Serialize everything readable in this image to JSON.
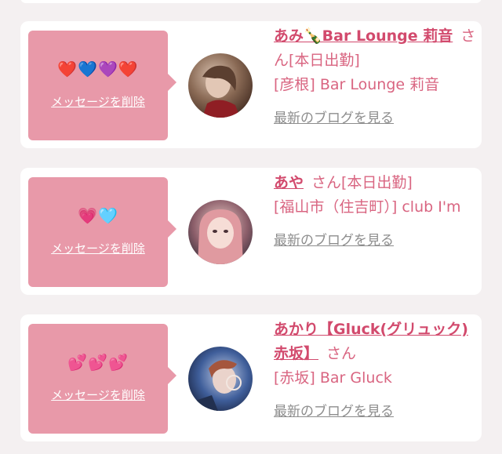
{
  "cards": [
    {
      "emojis": "❤️💙💜❤️",
      "delete_label": "メッセージを削除",
      "name": "あみ🍾Bar Lounge 莉音",
      "suffix": "さん[本日出勤]",
      "location": "[彦根] Bar Lounge 莉音",
      "blog_label": "最新のブログを見る"
    },
    {
      "emojis": "💗🩵",
      "delete_label": "メッセージを削除",
      "name": "あや",
      "suffix": "さん[本日出勤]",
      "location": "[福山市（住吉町）] club I'm",
      "blog_label": "最新のブログを見る"
    },
    {
      "emojis": "💕💕💕",
      "delete_label": "メッセージを削除",
      "name": "あかり【Gluck(グリュック)赤坂】",
      "suffix": "さん",
      "location": "[赤坂] Bar Gluck",
      "blog_label": "最新のブログを見る"
    }
  ]
}
